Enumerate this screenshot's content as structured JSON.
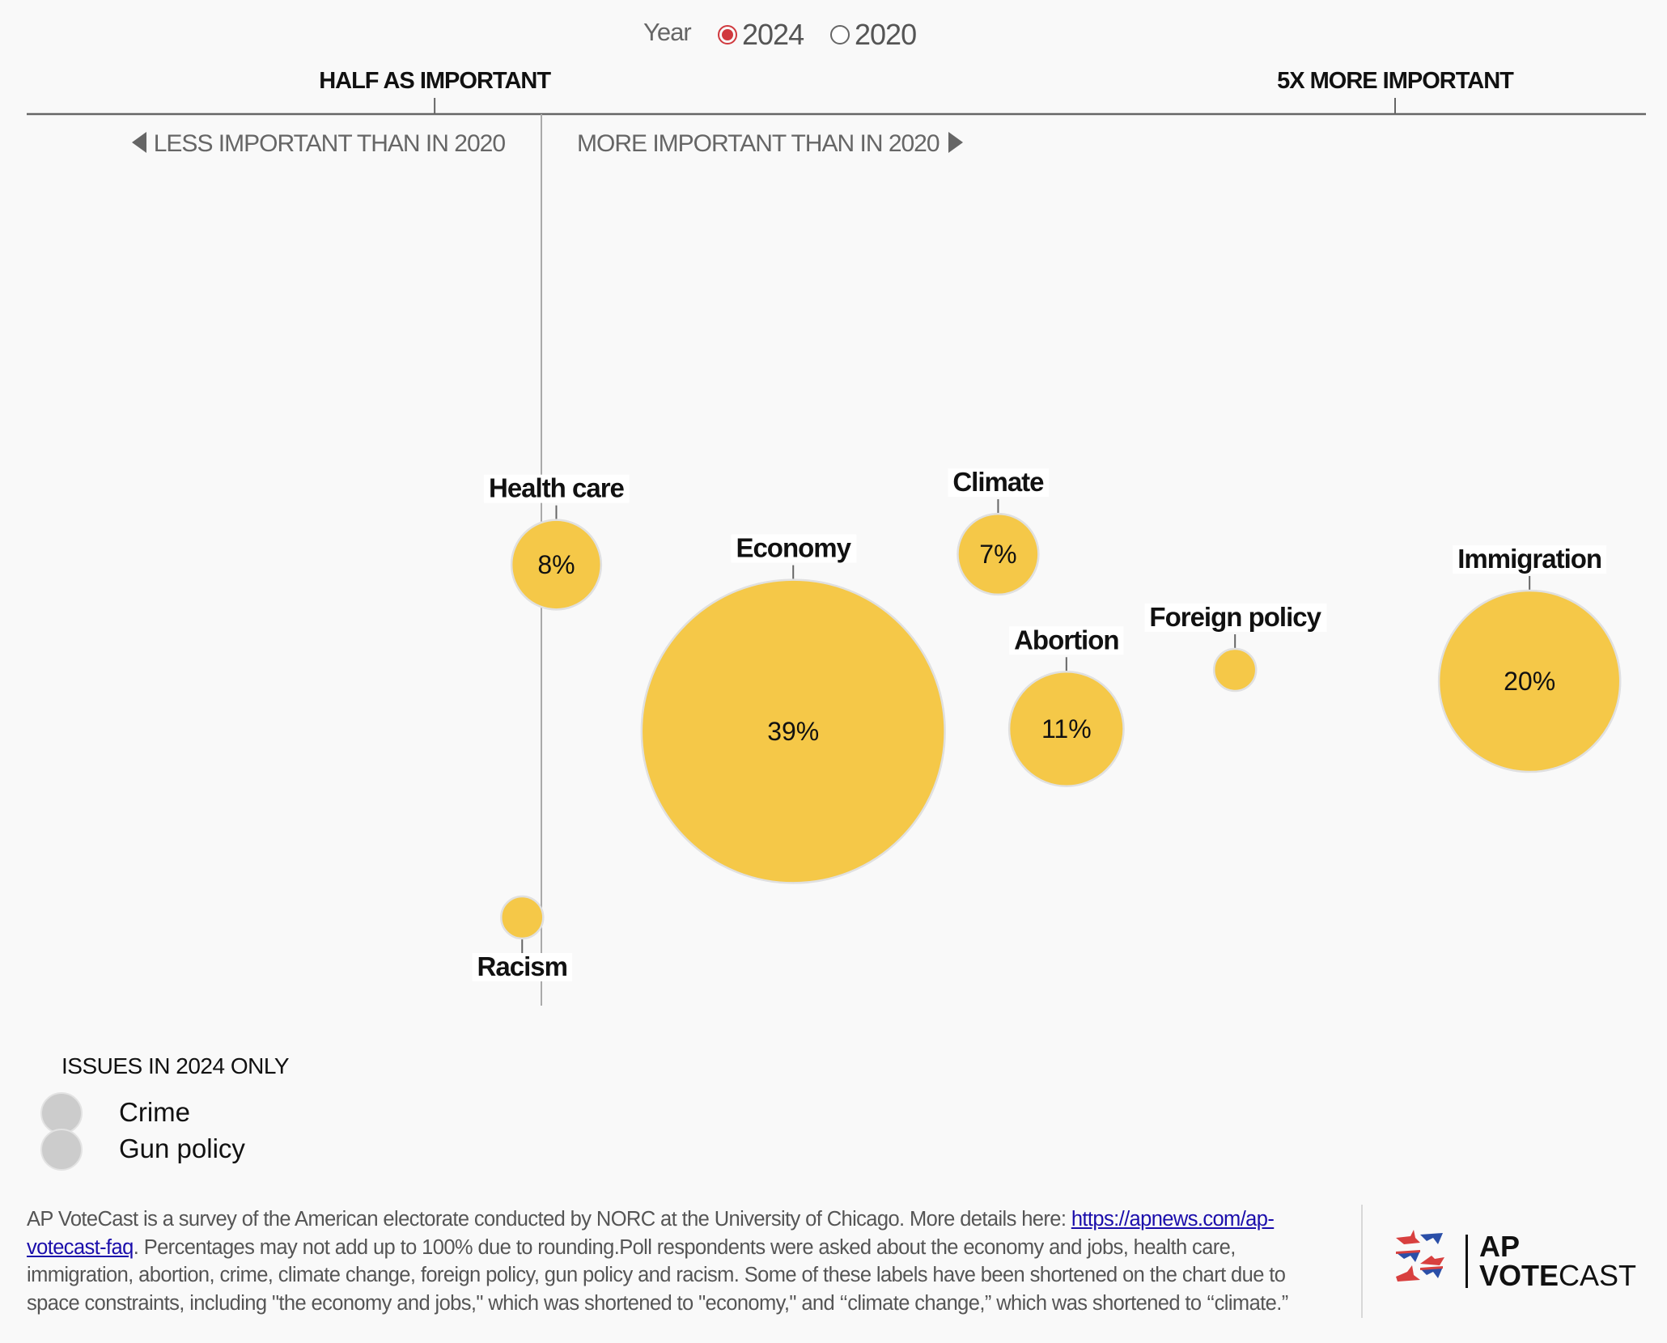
{
  "year_toggle": {
    "label": "Year",
    "options": [
      {
        "label": "2024",
        "selected": true
      },
      {
        "label": "2020",
        "selected": false
      }
    ],
    "selected_color": "#d0393e"
  },
  "chart_data": {
    "type": "scatter",
    "subtype": "bubble",
    "title": "",
    "x_axis": {
      "meaning": "Importance of issue in 2024 relative to 2020 (ratio)",
      "ticks": [
        {
          "value": 0.5,
          "label": "HALF AS IMPORTANT"
        },
        {
          "value": 5,
          "label": "5X MORE IMPORTANT"
        }
      ],
      "reference_value": 1,
      "left_direction_label": "LESS IMPORTANT THAN IN 2020",
      "right_direction_label": "MORE IMPORTANT THAN IN 2020",
      "range": [
        0.0,
        6.0
      ]
    },
    "size_meaning": "Share of voters naming issue most important, 2024 (%)",
    "bubble_color": "#f5c848",
    "bubble_stroke": "#e0e0e0",
    "points": [
      {
        "name": "Health care",
        "ratio": 1.07,
        "pct": 8,
        "pct_label": "8%",
        "label_pos": "above"
      },
      {
        "name": "Economy",
        "ratio": 2.18,
        "pct": 39,
        "pct_label": "39%",
        "label_pos": "above"
      },
      {
        "name": "Climate",
        "ratio": 3.14,
        "pct": 7,
        "pct_label": "7%",
        "label_pos": "above"
      },
      {
        "name": "Abortion",
        "ratio": 3.46,
        "pct": 11,
        "pct_label": "11%",
        "label_pos": "above"
      },
      {
        "name": "Foreign policy",
        "ratio": 4.25,
        "pct": 3,
        "pct_label": "",
        "label_pos": "above"
      },
      {
        "name": "Immigration",
        "ratio": 5.63,
        "pct": 20,
        "pct_label": "20%",
        "label_pos": "above"
      },
      {
        "name": "Racism",
        "ratio": 0.91,
        "pct": 3,
        "pct_label": "",
        "label_pos": "below"
      }
    ],
    "legend": {
      "title": "ISSUES IN 2024 ONLY",
      "items": [
        "Crime",
        "Gun policy"
      ],
      "swatch_color": "#cccccc"
    }
  },
  "footnote": {
    "text_before_link": "AP VoteCast is a survey of the American electorate conducted by NORC at the University of Chicago. More details here: ",
    "link_text": "https://apnews.com/ap-votecast-faq",
    "text_after_link": ". Percentages may not add up to 100% due to rounding.Poll respondents were asked about the economy and jobs, health care, immigration, abortion, crime, climate change, foreign policy, gun policy and racism. Some of these labels have been shortened on the chart due to space constraints, including \"the economy and jobs,\" which was shortened to \"economy,\" and ‘‘climate change,” which was shortened to ‘‘climate.”"
  },
  "logo": {
    "line1": "AP",
    "line2_bold": "VOTE",
    "line2_regular": "CAST",
    "star_colors": [
      "#d8403f",
      "#2b4fa8"
    ]
  }
}
